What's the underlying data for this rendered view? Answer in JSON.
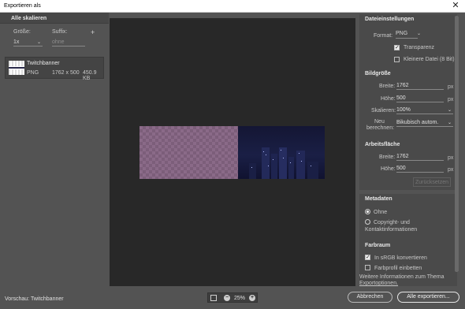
{
  "window": {
    "title": "Exportieren als",
    "close_icon": "close-icon"
  },
  "left": {
    "header": "Alle skalieren",
    "size_label": "Größe:",
    "suffix_label": "Suffix:",
    "scale_value": "1x",
    "suffix_placeholder": "ohne",
    "add_icon": "plus-icon",
    "asset": {
      "name": "Twitchbanner",
      "format": "PNG",
      "dimensions": "1762 x 500",
      "filesize": "450.9 KB"
    }
  },
  "preview": {
    "zoom": "25%",
    "fit_icon": "fit-screen-icon",
    "zoom_out_icon": "zoom-out-icon",
    "zoom_in_icon": "zoom-in-icon"
  },
  "file_settings": {
    "header": "Dateieinstellungen",
    "format_label": "Format:",
    "format_value": "PNG",
    "transparency_label": "Transparenz",
    "transparency_checked": true,
    "smaller_file_label": "Kleinere Datei (8 Bit)",
    "smaller_file_checked": false
  },
  "image_size": {
    "header": "Bildgröße",
    "width_label": "Breite:",
    "width_value": "1762",
    "height_label": "Höhe:",
    "height_value": "500",
    "scale_label": "Skalieren:",
    "scale_value": "100%",
    "resample_label_1": "Neu",
    "resample_label_2": "berechnen:",
    "resample_value": "Bikubisch autom.",
    "unit": "px"
  },
  "canvas_size": {
    "header": "Arbeitsfläche",
    "width_label": "Breite:",
    "width_value": "1762",
    "height_label": "Höhe:",
    "height_value": "500",
    "reset_label": "Zurücksetzen",
    "unit": "px"
  },
  "metadata": {
    "header": "Metadaten",
    "option_none": "Ohne",
    "option_copyright_1": "Copyright- und",
    "option_copyright_2": "Kontaktinformationen",
    "selected": "Ohne"
  },
  "color_space": {
    "header": "Farbraum",
    "srgb_label": "In sRGB konvertieren",
    "srgb_checked": true,
    "embed_label": "Farbprofil einbetten",
    "embed_checked": false,
    "info_1": "Weitere Informationen zum Thema",
    "info_2": "Exportoptionen."
  },
  "footer": {
    "preview_label": "Vorschau: Twitchbanner",
    "cancel": "Abbrechen",
    "export_all": "Alle exportieren..."
  }
}
